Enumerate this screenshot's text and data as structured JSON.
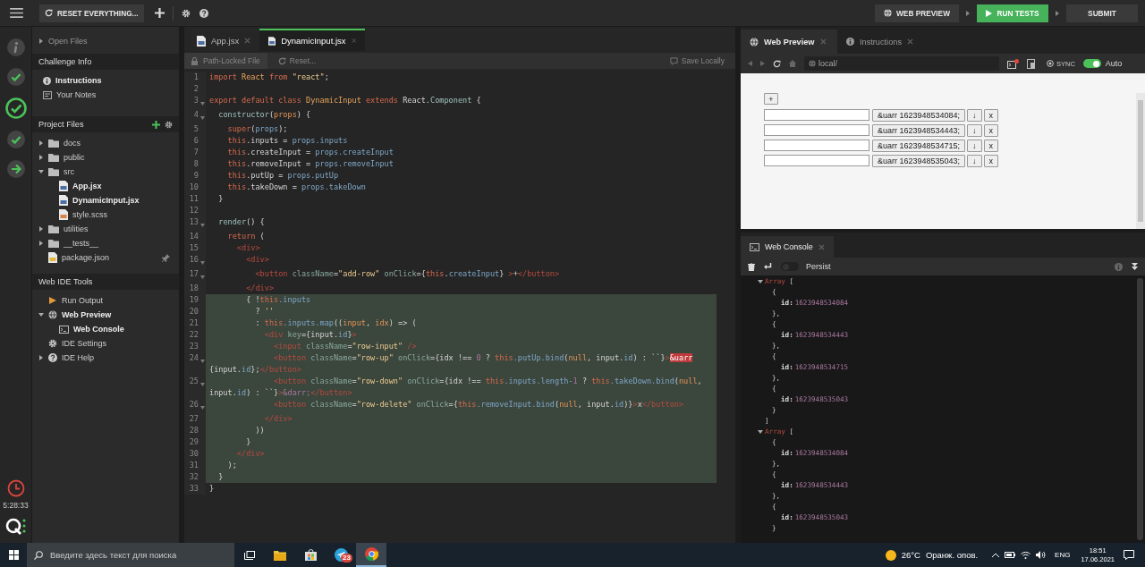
{
  "topbar": {
    "reset_button": "RESET EVERYTHING...",
    "web_preview_button": "WEB PREVIEW",
    "run_tests_button": "RUN TESTS",
    "submit_button": "SUBMIT"
  },
  "rail": {
    "steps": [
      {
        "kind": "info"
      },
      {
        "kind": "done"
      },
      {
        "kind": "current"
      },
      {
        "kind": "done"
      },
      {
        "kind": "next"
      }
    ],
    "timer": "5:28:33"
  },
  "sidebar": {
    "open_files": {
      "label": "Open Files",
      "expanded": false
    },
    "challenge_info": {
      "title": "Challenge Info",
      "items": [
        {
          "kind": "instructions",
          "label": "Instructions",
          "active": true
        },
        {
          "kind": "notes",
          "label": "Your Notes",
          "active": false
        }
      ]
    },
    "project_files": {
      "title": "Project Files",
      "tree": [
        {
          "kind": "folder",
          "label": "docs",
          "expanded": false
        },
        {
          "kind": "folder",
          "label": "public",
          "expanded": false
        },
        {
          "kind": "folder",
          "label": "src",
          "expanded": true,
          "children": [
            {
              "kind": "jsx",
              "label": "App.jsx",
              "open": true,
              "pinned": false
            },
            {
              "kind": "jsx",
              "label": "DynamicInput.jsx",
              "open": true,
              "pinned": false
            },
            {
              "kind": "scss",
              "label": "style.scss",
              "open": false,
              "pinned": false
            }
          ]
        },
        {
          "kind": "folder",
          "label": "utilities",
          "expanded": false
        },
        {
          "kind": "folder",
          "label": "__tests__",
          "expanded": false
        },
        {
          "kind": "json",
          "label": "package.json",
          "open": false,
          "pinned": true
        }
      ]
    },
    "tools": {
      "title": "Web IDE Tools",
      "tree": [
        {
          "kind": "run",
          "label": "Run Output",
          "active": false
        },
        {
          "kind": "preview",
          "label": "Web Preview",
          "active": true,
          "expanded": true,
          "children": [
            {
              "kind": "console",
              "label": "Web Console",
              "active": true
            }
          ]
        },
        {
          "kind": "settings",
          "label": "IDE Settings",
          "active": false
        },
        {
          "kind": "help",
          "label": "IDE Help",
          "active": false,
          "expanded": false
        }
      ]
    }
  },
  "editor": {
    "tabs": [
      {
        "label": "App.jsx",
        "selected": false
      },
      {
        "label": "DynamicInput.jsx",
        "selected": true
      }
    ],
    "locked_label": "Path-Locked File",
    "reset_label": "Reset...",
    "save_label": "Save Locally",
    "lines": [
      {
        "n": "1",
        "fold": false,
        "selected": false,
        "tokens": [
          {
            "kind": "kw",
            "text": "import "
          },
          {
            "kind": "cls",
            "text": "React "
          },
          {
            "kind": "kw",
            "text": "from "
          },
          {
            "kind": "str",
            "text": "\"react\""
          },
          {
            "kind": "pl",
            "text": ";"
          }
        ]
      },
      {
        "n": "2",
        "fold": false,
        "selected": false
      },
      {
        "n": "3",
        "fold": true,
        "selected": false,
        "tokens": [
          {
            "kind": "kw",
            "text": "export default class "
          },
          {
            "kind": "cls",
            "text": "DynamicInput "
          },
          {
            "kind": "kw",
            "text": "extends "
          },
          {
            "kind": "pl",
            "text": "React."
          },
          {
            "kind": "fn",
            "text": "Component"
          },
          {
            "kind": "pl",
            "text": " {"
          }
        ]
      },
      {
        "n": "4",
        "fold": true,
        "selected": false,
        "tokens": [
          {
            "kind": "fn",
            "text": "  constructor"
          },
          {
            "kind": "pl",
            "text": "("
          },
          {
            "kind": "par",
            "text": "props"
          },
          {
            "kind": "pl",
            "text": ") {"
          }
        ]
      },
      {
        "n": "5",
        "fold": false,
        "selected": false,
        "tokens": [
          {
            "kind": "kw",
            "text": "    super"
          },
          {
            "kind": "pl",
            "text": "("
          },
          {
            "kind": "prop",
            "text": "props"
          },
          {
            "kind": "pl",
            "text": ");"
          }
        ]
      },
      {
        "n": "6",
        "fold": false,
        "selected": false,
        "tokens": [
          {
            "kind": "kw",
            "text": "    this"
          },
          {
            "kind": "pl",
            "text": ".inputs = "
          },
          {
            "kind": "prop",
            "text": "props.inputs"
          }
        ]
      },
      {
        "n": "7",
        "fold": false,
        "selected": false,
        "tokens": [
          {
            "kind": "kw",
            "text": "    this"
          },
          {
            "kind": "pl",
            "text": ".createInput = "
          },
          {
            "kind": "prop",
            "text": "props.createInput"
          }
        ]
      },
      {
        "n": "8",
        "fold": false,
        "selected": false,
        "tokens": [
          {
            "kind": "kw",
            "text": "    this"
          },
          {
            "kind": "pl",
            "text": ".removeInput = "
          },
          {
            "kind": "prop",
            "text": "props.removeInput"
          }
        ]
      },
      {
        "n": "9",
        "fold": false,
        "selected": false,
        "tokens": [
          {
            "kind": "kw",
            "text": "    this"
          },
          {
            "kind": "pl",
            "text": ".putUp = "
          },
          {
            "kind": "prop",
            "text": "props.putUp"
          }
        ]
      },
      {
        "n": "10",
        "fold": false,
        "selected": false,
        "tokens": [
          {
            "kind": "kw",
            "text": "    this"
          },
          {
            "kind": "pl",
            "text": ".takeDown = "
          },
          {
            "kind": "prop",
            "text": "props.takeDown"
          }
        ]
      },
      {
        "n": "11",
        "fold": false,
        "selected": false,
        "tokens": [
          {
            "kind": "pl",
            "text": "  }"
          }
        ]
      },
      {
        "n": "12",
        "fold": false,
        "selected": false
      },
      {
        "n": "13",
        "fold": true,
        "selected": false,
        "tokens": [
          {
            "kind": "fn",
            "text": "  render"
          },
          {
            "kind": "pl",
            "text": "() {"
          }
        ]
      },
      {
        "n": "14",
        "fold": false,
        "selected": false,
        "tokens": [
          {
            "kind": "kw",
            "text": "    return"
          },
          {
            "kind": "pl",
            "text": " ("
          }
        ]
      },
      {
        "n": "15",
        "fold": false,
        "selected": false,
        "tokens": [
          {
            "kind": "tag",
            "text": "      <div>"
          }
        ]
      },
      {
        "n": "16",
        "fold": true,
        "selected": false,
        "tokens": [
          {
            "kind": "tag",
            "text": "        <div>"
          }
        ]
      },
      {
        "n": "17",
        "fold": true,
        "selected": false,
        "tokens": [
          {
            "kind": "tag",
            "text": "          <button "
          },
          {
            "kind": "attr",
            "text": "className"
          },
          {
            "kind": "pl",
            "text": "="
          },
          {
            "kind": "str",
            "text": "\"add-row\""
          },
          {
            "kind": "attr",
            "text": " onClick"
          },
          {
            "kind": "pl",
            "text": "={"
          },
          {
            "kind": "kw",
            "text": "this"
          },
          {
            "kind": "pl",
            "text": "."
          },
          {
            "kind": "prop",
            "text": "createInput"
          },
          {
            "kind": "pl",
            "text": "} "
          },
          {
            "kind": "tag",
            "text": ">"
          },
          {
            "kind": "pl",
            "text": "+"
          },
          {
            "kind": "tag",
            "text": "</button>"
          }
        ]
      },
      {
        "n": "18",
        "fold": false,
        "selected": false,
        "tokens": [
          {
            "kind": "tag",
            "text": "        </div>"
          }
        ]
      },
      {
        "n": "19",
        "fold": false,
        "selected": true,
        "tokens": [
          {
            "kind": "pl",
            "text": "        { !"
          },
          {
            "kind": "kw",
            "text": "this"
          },
          {
            "kind": "prop",
            "text": ".inputs"
          }
        ]
      },
      {
        "n": "20",
        "fold": false,
        "selected": true,
        "tokens": [
          {
            "kind": "pl",
            "text": "          ? "
          },
          {
            "kind": "str",
            "text": "''"
          }
        ]
      },
      {
        "n": "21",
        "fold": false,
        "selected": true,
        "tokens": [
          {
            "kind": "pl",
            "text": "          : "
          },
          {
            "kind": "kw",
            "text": "this"
          },
          {
            "kind": "prop",
            "text": ".inputs.map"
          },
          {
            "kind": "pl",
            "text": "(("
          },
          {
            "kind": "par",
            "text": "input"
          },
          {
            "kind": "pl",
            "text": ", "
          },
          {
            "kind": "par",
            "text": "idx"
          },
          {
            "kind": "pl",
            "text": ") => ("
          }
        ]
      },
      {
        "n": "22",
        "fold": false,
        "selected": true,
        "tokens": [
          {
            "kind": "tag",
            "text": "            <div "
          },
          {
            "kind": "attr",
            "text": "key"
          },
          {
            "kind": "pl",
            "text": "={input."
          },
          {
            "kind": "prop",
            "text": "id"
          },
          {
            "kind": "pl",
            "text": "}"
          },
          {
            "kind": "tag",
            "text": ">"
          }
        ]
      },
      {
        "n": "23",
        "fold": false,
        "selected": true,
        "tokens": [
          {
            "kind": "tag",
            "text": "              <input "
          },
          {
            "kind": "attr",
            "text": "className"
          },
          {
            "kind": "pl",
            "text": "="
          },
          {
            "kind": "str",
            "text": "\"row-input\""
          },
          {
            "kind": "tag",
            "text": " />"
          }
        ]
      },
      {
        "n": "24",
        "fold": true,
        "selected": true,
        "tokens": [
          {
            "kind": "tag",
            "text": "              <button "
          },
          {
            "kind": "attr",
            "text": "className"
          },
          {
            "kind": "pl",
            "text": "="
          },
          {
            "kind": "str",
            "text": "\"row-up\""
          },
          {
            "kind": "attr",
            "text": " onClick"
          },
          {
            "kind": "pl",
            "text": "={idx !== "
          },
          {
            "kind": "num",
            "text": "0"
          },
          {
            "kind": "pl",
            "text": " ? "
          },
          {
            "kind": "kw",
            "text": "this"
          },
          {
            "kind": "prop",
            "text": ".putUp.bind"
          },
          {
            "kind": "pl",
            "text": "("
          },
          {
            "kind": "par",
            "text": "null"
          },
          {
            "kind": "pl",
            "text": ", input."
          },
          {
            "kind": "prop",
            "text": "id"
          },
          {
            "kind": "pl",
            "text": ") : ``}"
          },
          {
            "kind": "tag",
            "text": ">"
          },
          {
            "kind": "err",
            "text": "&uarr"
          },
          {
            "kind": "br"
          },
          {
            "kind": "pl",
            "text": "{input."
          },
          {
            "kind": "prop",
            "text": "id"
          },
          {
            "kind": "pl",
            "text": "};"
          },
          {
            "kind": "tag",
            "text": "</button>"
          }
        ]
      },
      {
        "n": "25",
        "fold": true,
        "selected": true,
        "tokens": [
          {
            "kind": "tag",
            "text": "              <button "
          },
          {
            "kind": "attr",
            "text": "className"
          },
          {
            "kind": "pl",
            "text": "="
          },
          {
            "kind": "str",
            "text": "\"row-down\""
          },
          {
            "kind": "attr",
            "text": " onClick"
          },
          {
            "kind": "pl",
            "text": "={idx !== "
          },
          {
            "kind": "kw",
            "text": "this"
          },
          {
            "kind": "prop",
            "text": ".inputs.length-"
          },
          {
            "kind": "num",
            "text": "1"
          },
          {
            "kind": "pl",
            "text": " ? "
          },
          {
            "kind": "kw",
            "text": "this"
          },
          {
            "kind": "prop",
            "text": ".takeDown.bind"
          },
          {
            "kind": "pl",
            "text": "("
          },
          {
            "kind": "par",
            "text": "null"
          },
          {
            "kind": "pl",
            "text": ","
          },
          {
            "kind": "br"
          },
          {
            "kind": "pl",
            "text": "input."
          },
          {
            "kind": "prop",
            "text": "id"
          },
          {
            "kind": "pl",
            "text": ") : ``}"
          },
          {
            "kind": "tag",
            "text": ">"
          },
          {
            "kind": "num",
            "text": "&darr;"
          },
          {
            "kind": "tag",
            "text": "</button>"
          }
        ]
      },
      {
        "n": "26",
        "fold": true,
        "selected": true,
        "tokens": [
          {
            "kind": "tag",
            "text": "              <button "
          },
          {
            "kind": "attr",
            "text": "className"
          },
          {
            "kind": "pl",
            "text": "="
          },
          {
            "kind": "str",
            "text": "\"row-delete\""
          },
          {
            "kind": "attr",
            "text": " onClick"
          },
          {
            "kind": "pl",
            "text": "={"
          },
          {
            "kind": "kw",
            "text": "this"
          },
          {
            "kind": "prop",
            "text": ".removeInput.bind"
          },
          {
            "kind": "pl",
            "text": "("
          },
          {
            "kind": "par",
            "text": "null"
          },
          {
            "kind": "pl",
            "text": ", input."
          },
          {
            "kind": "prop",
            "text": "id"
          },
          {
            "kind": "pl",
            "text": ")}"
          },
          {
            "kind": "tag",
            "text": ">"
          },
          {
            "kind": "pl",
            "text": "x"
          },
          {
            "kind": "tag",
            "text": "</button>"
          }
        ]
      },
      {
        "n": "27",
        "fold": false,
        "selected": true,
        "tokens": [
          {
            "kind": "tag",
            "text": "            </div>"
          }
        ]
      },
      {
        "n": "28",
        "fold": false,
        "selected": true,
        "tokens": [
          {
            "kind": "pl",
            "text": "          ))"
          }
        ]
      },
      {
        "n": "29",
        "fold": false,
        "selected": true,
        "tokens": [
          {
            "kind": "pl",
            "text": "        }"
          }
        ]
      },
      {
        "n": "30",
        "fold": false,
        "selected": true,
        "tokens": [
          {
            "kind": "tag",
            "text": "      </div>"
          }
        ]
      },
      {
        "n": "31",
        "fold": false,
        "selected": true,
        "tokens": [
          {
            "kind": "pl",
            "text": "    );"
          }
        ]
      },
      {
        "n": "32",
        "fold": false,
        "selected": true,
        "tokens": [
          {
            "kind": "pl",
            "text": "  }"
          }
        ]
      },
      {
        "n": "33",
        "fold": false,
        "selected": false,
        "tokens": [
          {
            "kind": "pl",
            "text": "}"
          }
        ]
      }
    ]
  },
  "preview": {
    "tabs": [
      {
        "label": "Web Preview",
        "selected": true
      },
      {
        "label": "Instructions",
        "selected": false
      }
    ],
    "url": "local/",
    "sync_label": "SYNC",
    "auto": {
      "label": "Auto",
      "on": true
    },
    "page": {
      "add_button": "+",
      "rows": [
        {
          "up_button": "&uarr 1623948534084;",
          "down_button": "↓",
          "delete_button": "x"
        },
        {
          "up_button": "&uarr 1623948534443;",
          "down_button": "↓",
          "delete_button": "x"
        },
        {
          "up_button": "&uarr 1623948534715;",
          "down_button": "↓",
          "delete_button": "x"
        },
        {
          "up_button": "&uarr 1623948535043;",
          "down_button": "↓",
          "delete_button": "x"
        }
      ]
    }
  },
  "console": {
    "tab": "Web Console",
    "persist": {
      "label": "Persist",
      "on": false
    },
    "logs": [
      {
        "label": "Array",
        "open": "[",
        "close": "]",
        "expanded": true,
        "entries": [
          {
            "open": "{",
            "key": "id:",
            "value": "1623948534084",
            "close": "},"
          },
          {
            "open": "{",
            "key": "id:",
            "value": "1623948534443",
            "close": "},"
          },
          {
            "open": "{",
            "key": "id:",
            "value": "1623948534715",
            "close": "},"
          },
          {
            "open": "{",
            "key": "id:",
            "value": "1623948535043",
            "close": "}"
          }
        ]
      },
      {
        "label": "Array",
        "open": "[",
        "expanded": true,
        "entries": [
          {
            "open": "{",
            "key": "id:",
            "value": "1623948534084",
            "close": "},"
          },
          {
            "open": "{",
            "key": "id:",
            "value": "1623948534443",
            "close": "},"
          },
          {
            "open": "{",
            "key": "id:",
            "value": "1623948535043",
            "close": "}"
          }
        ]
      }
    ]
  },
  "taskbar": {
    "search_placeholder": "Введите здесь текст для поиска",
    "apps": [
      {
        "kind": "taskview",
        "active": false
      },
      {
        "kind": "folder",
        "active": false
      },
      {
        "kind": "store",
        "active": false
      },
      {
        "kind": "messenger",
        "active": false,
        "badge": "23"
      },
      {
        "kind": "browser",
        "active": true
      }
    ],
    "weather": "26°C",
    "weather_note": "Оранж. опов.",
    "language": "ENG",
    "time": "18:51",
    "date": "17.06.2021"
  }
}
